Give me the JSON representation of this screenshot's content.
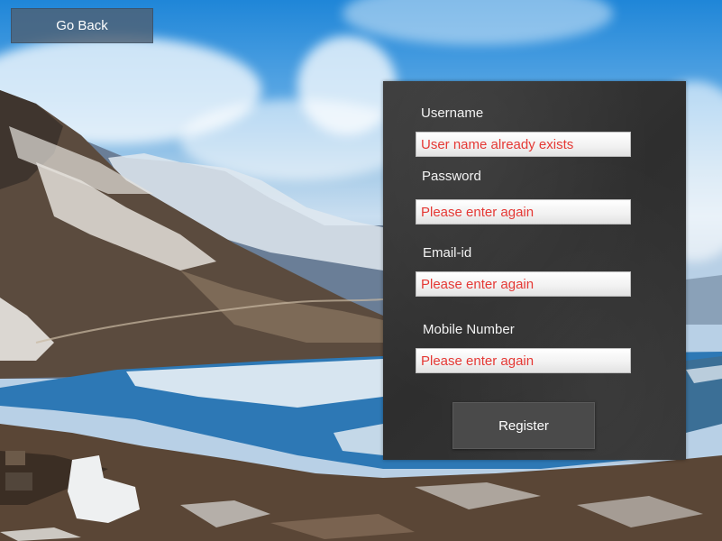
{
  "header": {
    "back_label": "Go Back"
  },
  "form": {
    "username": {
      "label": "Username",
      "value": "User name already exists"
    },
    "password": {
      "label": "Password",
      "value": "Please enter again"
    },
    "email": {
      "label": "Email-id",
      "value": "Please enter again"
    },
    "mobile": {
      "label": "Mobile Number",
      "value": "Please enter again"
    },
    "submit_label": "Register"
  },
  "colors": {
    "error_text": "#e53935",
    "panel_bg": "#333333",
    "button_bg": "#4a4a4a"
  }
}
